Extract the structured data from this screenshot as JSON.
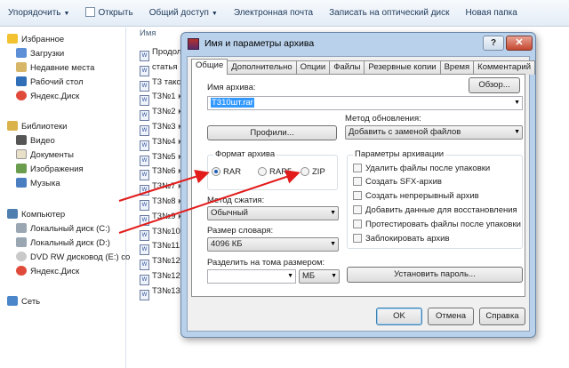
{
  "toolbar": {
    "organize": "Упорядочить",
    "open": "Открыть",
    "share": "Общий доступ",
    "email": "Электронная почта",
    "burn": "Записать на оптический диск",
    "new_folder": "Новая папка"
  },
  "nav": {
    "favorites": "Избранное",
    "downloads": "Загрузки",
    "recent": "Недавние места",
    "desktop": "Рабочий стол",
    "yandex1": "Яндекс.Диск",
    "libraries": "Библиотеки",
    "video": "Видео",
    "documents": "Документы",
    "images": "Изображения",
    "music": "Музыка",
    "computer": "Компьютер",
    "disk_c": "Локальный диск (C:)",
    "disk_d": "Локальный диск (D:)",
    "dvd": "DVD RW дисковод (E:) co",
    "yandex2": "Яндекс.Диск",
    "network": "Сеть"
  },
  "files": {
    "header": "Имя",
    "items": [
      "Продол",
      "статья",
      "Т3 такс",
      "Т3№1 к",
      "Т3№2 к",
      "Т3№3 к",
      "Т3№4 к",
      "Т3№5 к",
      "Т3№6 к",
      "Т3№7 к",
      "Т3№8 к",
      "Т3№9 к",
      "Т3№10",
      "Т3№11",
      "Т3№12",
      "Т3№12",
      "Т3№13"
    ]
  },
  "dialog": {
    "title": "Имя и параметры архива",
    "help": "?",
    "close": "✕",
    "tabs": [
      "Общие",
      "Дополнительно",
      "Опции",
      "Файлы",
      "Резервные копии",
      "Время",
      "Комментарий"
    ],
    "archive_name_label": "Имя архива:",
    "browse": "Обзор...",
    "archive_name_value": "Т310шт.rar",
    "update_method_label": "Метод обновления:",
    "update_method_value": "Добавить с заменой файлов",
    "profiles": "Профили...",
    "format_group": "Формат архива",
    "formats": [
      "RAR",
      "RAR5",
      "ZIP"
    ],
    "compression_label": "Метод сжатия:",
    "compression_value": "Обычный",
    "dict_label": "Размер словаря:",
    "dict_value": "4096 КБ",
    "split_label": "Разделить на тома размером:",
    "split_unit": "МБ",
    "params_group": "Параметры архивации",
    "options": [
      "Удалить файлы после упаковки",
      "Создать SFX-архив",
      "Создать непрерывный архив",
      "Добавить данные для восстановления",
      "Протестировать файлы после упаковки",
      "Заблокировать архив"
    ],
    "set_password": "Установить пароль...",
    "ok": "OK",
    "cancel": "Отмена",
    "help_btn": "Справка"
  }
}
